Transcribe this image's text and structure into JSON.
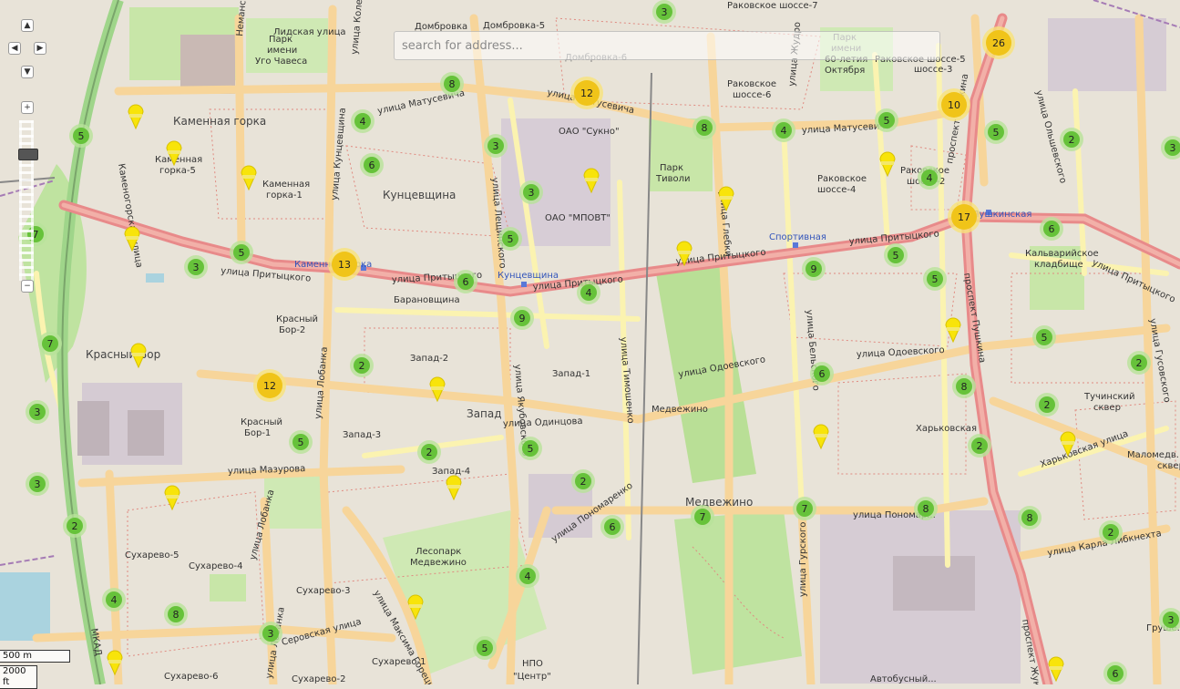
{
  "search": {
    "placeholder": "search for address..."
  },
  "controls": {
    "pan_up_icon": "▲",
    "pan_left_icon": "◀",
    "pan_right_icon": "▶",
    "pan_down_icon": "▼",
    "zoom_in_label": "+",
    "zoom_out_label": "−"
  },
  "scale": {
    "metric": "500 m",
    "imperial": "2000 ft"
  },
  "colors": {
    "cluster_green": "#66c23a",
    "cluster_green_halo": "#b8e29a",
    "cluster_yellow": "#f0c419",
    "cluster_yellow_halo": "#f7e27a",
    "pin": "#f8e40a",
    "major_road": "#e88a8a",
    "secondary_road": "#f7d59a",
    "tertiary_road": "#fbf3b0",
    "park": "#c8e6a8",
    "industrial": "#ddd0d8"
  },
  "clusters": [
    {
      "n": "3"
    },
    {
      "n": "26"
    },
    {
      "n": "12"
    },
    {
      "n": "8"
    },
    {
      "n": "10"
    },
    {
      "n": "4"
    },
    {
      "n": "5"
    },
    {
      "n": "8"
    },
    {
      "n": "4"
    },
    {
      "n": "5"
    },
    {
      "n": "2"
    },
    {
      "n": "3"
    },
    {
      "n": "5"
    },
    {
      "n": "3"
    },
    {
      "n": "6"
    },
    {
      "n": "3"
    },
    {
      "n": "4"
    },
    {
      "n": "17"
    },
    {
      "n": "6"
    },
    {
      "n": "7"
    },
    {
      "n": "5"
    },
    {
      "n": "5"
    },
    {
      "n": "3"
    },
    {
      "n": "13"
    },
    {
      "n": "6"
    },
    {
      "n": "5"
    },
    {
      "n": "9"
    },
    {
      "n": "5"
    },
    {
      "n": "4"
    },
    {
      "n": "9"
    },
    {
      "n": "7"
    },
    {
      "n": "5"
    },
    {
      "n": "2"
    },
    {
      "n": "12"
    },
    {
      "n": "6"
    },
    {
      "n": "3"
    },
    {
      "n": "8"
    },
    {
      "n": "2"
    },
    {
      "n": "5"
    },
    {
      "n": "2"
    },
    {
      "n": "3"
    },
    {
      "n": "2"
    },
    {
      "n": "5"
    },
    {
      "n": "2"
    },
    {
      "n": "8"
    },
    {
      "n": "6"
    },
    {
      "n": "7"
    },
    {
      "n": "7"
    },
    {
      "n": "8"
    },
    {
      "n": "2"
    },
    {
      "n": "2"
    },
    {
      "n": "4"
    },
    {
      "n": "4"
    },
    {
      "n": "8"
    },
    {
      "n": "3"
    },
    {
      "n": "3"
    },
    {
      "n": "5"
    },
    {
      "n": "6"
    },
    {
      "n": "2"
    }
  ],
  "labels": {
    "lidskaya": "Лидская улица",
    "dombrovka": "Домбровка",
    "dombrovka5": "Домбровка-5",
    "park_chavesa_1": "Парк",
    "park_chavesa_2": "имени",
    "park_chavesa_3": "Уго Чавеса",
    "park_60_1": "Парк",
    "park_60_2": "имени",
    "park_60_3": "60-летия",
    "park_60_4": "Октября",
    "rakovskoe7": "Раковское шоссе-7",
    "rakovskoe5": "Раковское шоссе-5",
    "rakovskoe3": "шоссе-3",
    "rakovskoe6_1": "Раковское",
    "rakovskoe6_2": "шоссе-6",
    "rakovskoe4_1": "Раковское",
    "rakovskoe4_2": "шоссе-4",
    "rakovskoe2_1": "Раковское",
    "rakovskoe2_2": "шоссе-2",
    "kamennaya_gorka": "Каменная горка",
    "kg5_1": "Каменная",
    "kg5_2": "горка-5",
    "kg1_1": "Каменная",
    "kg1_2": "горка-1",
    "matusevicha1": "улица Матусевича",
    "matusevicha2": "улица Матусевича",
    "matusevicha3": "улица Матусевича",
    "kuncevshchina": "Кунцевщина",
    "sukno": "ОАО \"Сукно\"",
    "mpovt": "ОАО \"МПОВТ\"",
    "park_tivoli_1": "Парк",
    "park_tivoli_2": "Тиволи",
    "pritytskogo1": "улица Притыцкого",
    "pritytskogo2": "улица Притыцкого",
    "pritytskogo3": "улица Притыцкого",
    "pritytskogo4": "улица Притыцкого",
    "pritytskogo5": "улица Притыцкого",
    "pritytskogo6": "улица Притыцкого",
    "metro_kamennaya": "Каменная горка",
    "metro_kuncevshchina": "Кунцевщина",
    "metro_sportivnaya": "Спортивная",
    "metro_pushkinskaya": "Пушкинская",
    "baranovshchina": "Барановщина",
    "krasny_bor2_1": "Красный",
    "krasny_bor2_2": "Бор-2",
    "krasny_bor": "Красный Бор",
    "krasny_bor1_1": "Красный",
    "krasny_bor1_2": "Бор-1",
    "zapad2": "Запад-2",
    "zapad1": "Запад-1",
    "zapad": "Запад",
    "zapad3": "Запад-3",
    "zapad4": "Запад-4",
    "odintsova": "улица Одинцова",
    "odoevskogo1": "улица Одоевского",
    "odoevskogo2": "улица Одоевского",
    "medvezhino": "Медвежино",
    "medvezhino2": "Медвежино",
    "kharkovskaya": "Харьковская",
    "kalvariyskoe_1": "Кальварийское",
    "kalvariyskoe_2": "кладбище",
    "tuchinsky_1": "Тучинский",
    "tuchinsky_2": "сквер",
    "mazurova": "улица Мазурова",
    "lobanka": "улица Лобанка",
    "lobanka2": "улица Лобанка",
    "sukharevo5": "Сухарево-5",
    "sukharevo4": "Сухарево-4",
    "sukharevo3": "Сухарево-3",
    "sukharevo6": "Сухарево-6",
    "sukharevo1": "Сухарево-1",
    "sukharevo2": "Сухарево-2",
    "lesopark_1": "Лесопарк",
    "lesopark_2": "Медвежино",
    "ponomarenko": "улица Пономаренко",
    "ponomarenko2": "улица Пономар...",
    "karla_libknekhta": "улица Карла Либкнехта",
    "kharkovskaya_st": "Харьковская улица",
    "malomedvedskaya_1": "Маломедв...",
    "malomedvedskaya_2": "сквер",
    "npo_1": "НПО",
    "npo_2": "\"Центр\"",
    "grushevka": "Груше...",
    "mkad": "МКАД",
    "pushkina": "проспект Пушкина",
    "pushkina2": "проспект Пушкина",
    "zhukova": "проспект Жукова",
    "kolesnikova": "улица Колесникова",
    "kuncevshchina_st": "улица Кунцевщина",
    "yakubovskogo": "улица Якубовского",
    "tymoshenko": "улица Тимошенко",
    "lobanka3": "улица Лобанка",
    "gurskogo": "улица Гурского",
    "belskogo": "улица Бельского",
    "glebki": "улица Глебки",
    "rudkina": "улица Жудро",
    "olshevskogo": "улица Ольшевского",
    "gusovskogo": "улица Гусовского",
    "serova": "Серовская улица",
    "kamenogorskaya": "Каменогорская улица",
    "nemanskaya": "Неманская улица",
    "gorky": "улица Максима Горецкого",
    "lyashkevicha": "улица Лещинского",
    "dombrovka6": "Домбровка-6",
    "avtobusny": "Автобусный..."
  }
}
